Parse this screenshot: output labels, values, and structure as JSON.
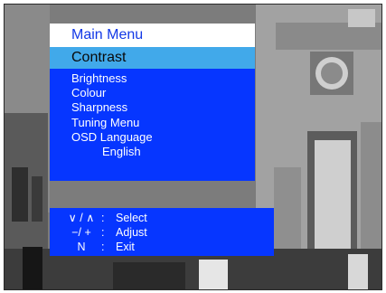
{
  "menu": {
    "title": "Main Menu",
    "selected": "Contrast",
    "items": [
      "Brightness",
      "Colour",
      "Sharpness",
      "Tuning Menu",
      "OSD Language"
    ],
    "language_value": "English"
  },
  "help": [
    {
      "key": "∨ / ∧",
      "action": "Select"
    },
    {
      "key": "−/ +",
      "action": "Adjust"
    },
    {
      "key": "N",
      "action": "Exit"
    }
  ],
  "help_separator": ":",
  "colors": {
    "menu_blue": "#0636ff",
    "highlight": "#41a9ea",
    "title_text": "#1238e6"
  }
}
